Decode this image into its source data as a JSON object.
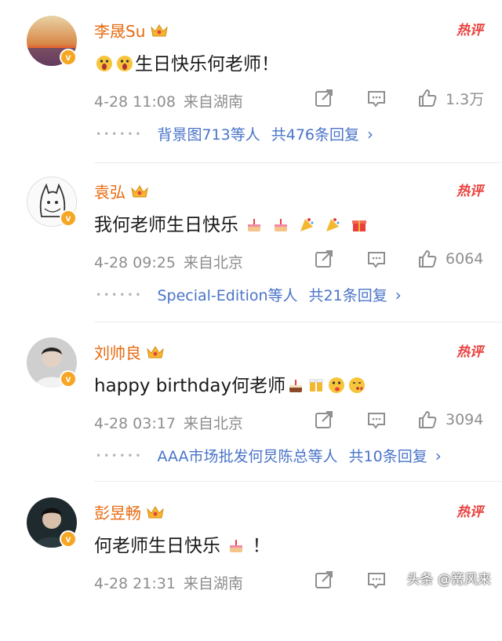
{
  "comments": [
    {
      "username": "李晟Su",
      "hot_label": "热评",
      "text": "生日快乐何老师！",
      "date": "4-28 11:08",
      "source": "来自湖南",
      "likes": "1.3万",
      "replies_names": "背景图713等人",
      "replies_count": "共476条回复",
      "avatar_icon": "sunset-avatar-icon"
    },
    {
      "username": "袁弘",
      "hot_label": "热评",
      "text": "我何老师生日快乐",
      "date": "4-28 09:25",
      "source": "来自北京",
      "likes": "6064",
      "replies_names": "Special-Edition等人",
      "replies_count": "共21条回复",
      "avatar_icon": "totoro-avatar-icon"
    },
    {
      "username": "刘帅良",
      "hot_label": "热评",
      "text": "happy birthday何老师",
      "date": "4-28 03:17",
      "source": "来自北京",
      "likes": "3094",
      "replies_names": "AAA市场批发何炅陈总等人",
      "replies_count": "共10条回复",
      "avatar_icon": "portrait-avatar-icon"
    },
    {
      "username": "彭昱畅",
      "hot_label": "热评",
      "text": "何老师生日快乐",
      "text_suffix": "！",
      "date": "4-28 21:31",
      "source": "来自湖南",
      "avatar_icon": "portrait-avatar-icon"
    }
  ],
  "watermark": "头条 @篝风来",
  "colors": {
    "username": "#e86a0f",
    "hot": "#e8403d",
    "link": "#4a74c9",
    "meta": "#8e8e8e"
  }
}
